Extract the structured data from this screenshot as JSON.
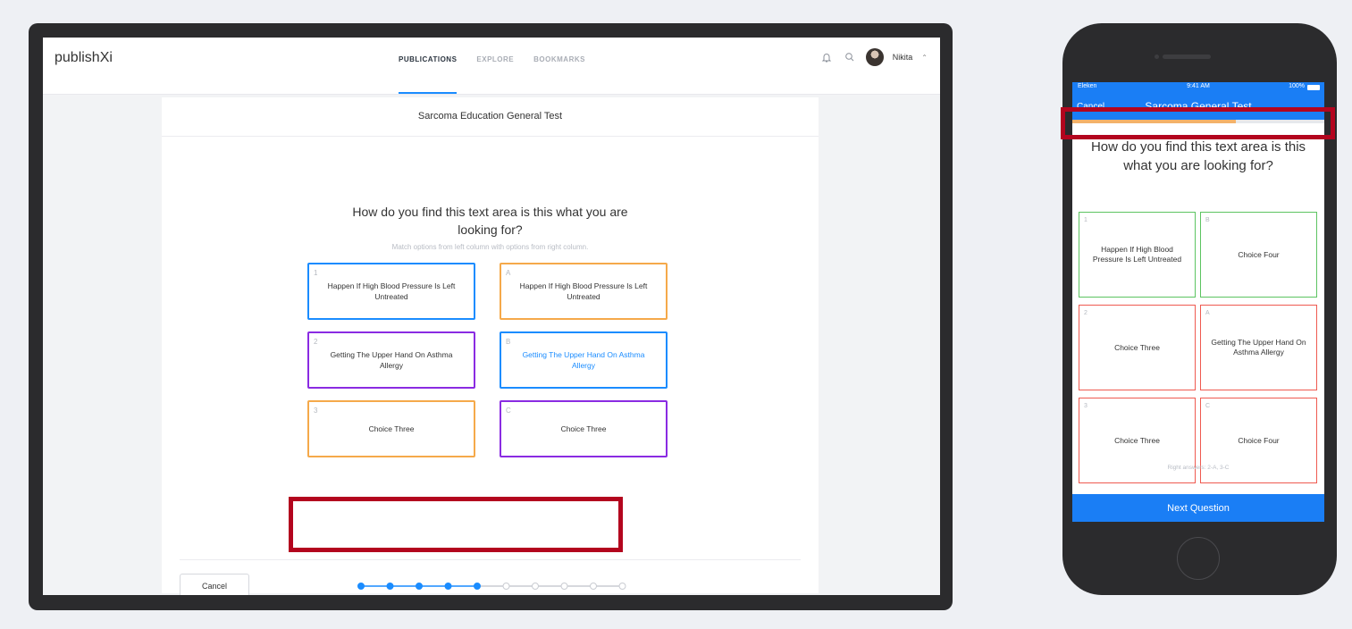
{
  "desktop": {
    "logo": "publishXi",
    "nav": [
      {
        "label": "PUBLICATIONS",
        "active": true
      },
      {
        "label": "EXPLORE",
        "active": false
      },
      {
        "label": "BOOKMARKS",
        "active": false
      }
    ],
    "icons": {
      "notifications": "bell-icon",
      "search": "search-icon",
      "menu": "chevron-up-icon"
    },
    "user_name": "Nikita",
    "test_title": "Sarcoma Education General Test",
    "question": "How do you find this text area is this what you are looking for?",
    "instruction": "Match options from left column with options from right column.",
    "left_options": [
      {
        "key": "1",
        "text": "Happen If High Blood Pressure Is Left Untreated",
        "border": "#1a8cff"
      },
      {
        "key": "2",
        "text": "Getting The Upper Hand On Asthma Allergy",
        "border": "#8a2be2"
      },
      {
        "key": "3",
        "text": "Choice Three",
        "border": "#f5a94a"
      }
    ],
    "right_options": [
      {
        "key": "A",
        "text": "Happen If High Blood Pressure Is Left Untreated",
        "border": "#f5a94a"
      },
      {
        "key": "B",
        "text": "Getting The Upper Hand On Asthma Allergy",
        "border": "#1a8cff",
        "text_color": "#1a8cff"
      },
      {
        "key": "C",
        "text": "Choice Three",
        "border": "#8a2be2"
      }
    ],
    "cancel_label": "Cancel",
    "progress": {
      "completed": 5,
      "total": 10
    }
  },
  "mobile": {
    "status": {
      "carrier": "Eleken",
      "time": "9:41 AM",
      "battery": "100%"
    },
    "cancel_label": "Cancel",
    "title": "Sarcoma General Test",
    "progress_fraction": 0.65,
    "question": "How do you find this text area is this what you are looking for?",
    "left_options": [
      {
        "key": "1",
        "text": "Happen If High Blood Pressure Is Left Untreated",
        "border": "#5cc461"
      },
      {
        "key": "2",
        "text": "Choice Three",
        "border": "#ef5a50"
      },
      {
        "key": "3",
        "text": "Choice Three",
        "border": "#ef5a50"
      }
    ],
    "right_options": [
      {
        "key": "B",
        "text": "Choice Four",
        "border": "#5cc461"
      },
      {
        "key": "A",
        "text": "Getting The Upper Hand On Asthma Allergy",
        "border": "#ef5a50"
      },
      {
        "key": "C",
        "text": "Choice Four",
        "border": "#ef5a50"
      }
    ],
    "right_answers": "Right answers: 2-A, 3-C",
    "next_label": "Next Question"
  },
  "colors": {
    "accent": "#1a8cff",
    "highlight": "#b3051e"
  }
}
